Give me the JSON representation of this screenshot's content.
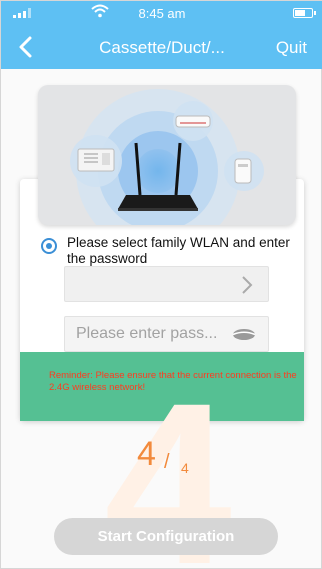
{
  "status_bar": {
    "time": "8:45 am"
  },
  "nav": {
    "title": "Cassette/Duct/...",
    "quit_label": "Quit"
  },
  "form": {
    "prompt": "Please select family WLAN and enter the password",
    "wlan_value": "",
    "password_placeholder": "Please enter pass...",
    "reminder": "Reminder: Please ensure that the current connection is the 2.4G wireless network!"
  },
  "step": {
    "current": "4",
    "separator": "/",
    "total": "4",
    "watermark": "4"
  },
  "actions": {
    "start_label": "Start Configuration"
  },
  "colors": {
    "header": "#5ec0f3",
    "accent_orange": "#f28a3c",
    "reminder_band": "#55c093",
    "reminder_text": "#ff3b1f",
    "radio": "#3b8fd6",
    "button_disabled": "#d6d6d6"
  },
  "icons": {
    "back": "chevron-left-icon",
    "wlan_arrow": "chevron-right-icon",
    "password_toggle": "eye-icon",
    "signal": "signal-icon",
    "wifi": "wifi-icon",
    "battery": "battery-icon"
  }
}
